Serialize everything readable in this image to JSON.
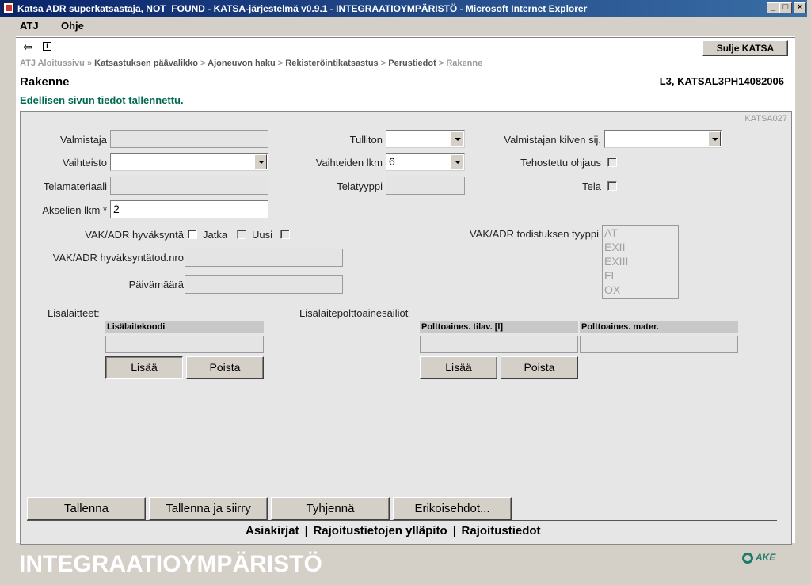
{
  "window": {
    "title": "Katsa ADR superkatsastaja, NOT_FOUND - KATSA-järjestelmä v0.9.1 - INTEGRAATIOYMPÄRISTÖ - Microsoft Internet Explorer",
    "minimize": "_",
    "maximize": "□",
    "close": "×"
  },
  "menu": {
    "items": [
      "ATJ",
      "Ohje"
    ]
  },
  "toolbar": {
    "back_icon": "⇦",
    "info_icon": "i",
    "close_label": "Sulje KATSA"
  },
  "breadcrumb": {
    "items": [
      "ATJ Aloitussivu",
      "Katsastuksen päävalikko",
      "Ajoneuvon haku",
      "Rekisteröintikatsastus",
      "Perustiedot",
      "Rakenne"
    ],
    "separators": [
      "»",
      ">",
      ">",
      ">",
      ">"
    ]
  },
  "page": {
    "title": "Rakenne",
    "id": "L3, KATSAL3PH14082006",
    "message": "Edellisen sivun tiedot tallennettu.",
    "code": "KATSA027"
  },
  "form": {
    "valmistaja": {
      "label": "Valmistaja",
      "value": ""
    },
    "tulliton": {
      "label": "Tulliton",
      "value": ""
    },
    "kilven_sij": {
      "label": "Valmistajan kilven sij.",
      "value": ""
    },
    "vaihteisto": {
      "label": "Vaihteisto",
      "value": ""
    },
    "vaihteiden_lkm": {
      "label": "Vaihteiden lkm",
      "value": "6"
    },
    "tehostettu": {
      "label": "Tehostettu ohjaus"
    },
    "telamateriaali": {
      "label": "Telamateriaali",
      "value": ""
    },
    "telatyyppi": {
      "label": "Telatyyppi",
      "value": ""
    },
    "tela": {
      "label": "Tela"
    },
    "akselien_lkm": {
      "label": "Akselien lkm *",
      "value": "2"
    },
    "vak_hyvaksynta": {
      "label": "VAK/ADR hyväksyntä",
      "jatka": "Jatka",
      "uusi": "Uusi"
    },
    "todistus_tyyppi": {
      "label": "VAK/ADR todistuksen tyyppi",
      "options": [
        "AT",
        "EXII",
        "EXIII",
        "FL",
        "OX"
      ]
    },
    "hyvaksyntatod_nro": {
      "label": "VAK/ADR hyväksyntätod.nro",
      "value": ""
    },
    "paivamaara": {
      "label": "Päivämäärä",
      "value": ""
    }
  },
  "lisalaitteet": {
    "title": "Lisälaitteet:",
    "column": "Lisälaitekoodi",
    "add": "Lisää",
    "remove": "Poista"
  },
  "sailiot": {
    "title": "Lisälaitepolttoainesäiliöt",
    "columns": [
      "Polttoaines. tilav. [l]",
      "Polttoaines. mater."
    ],
    "add": "Lisää",
    "remove": "Poista"
  },
  "actions": [
    "Tallenna",
    "Tallenna ja siirry",
    "Tyhjennä",
    "Erikoisehdot..."
  ],
  "footer_links": [
    "Asiakirjat",
    "Rajoitustietojen ylläpito",
    "Rajoitustiedot"
  ],
  "footer_separator": "|",
  "environment": "INTEGRAATIOYMPÄRISTÖ",
  "logo_text": "AKE"
}
